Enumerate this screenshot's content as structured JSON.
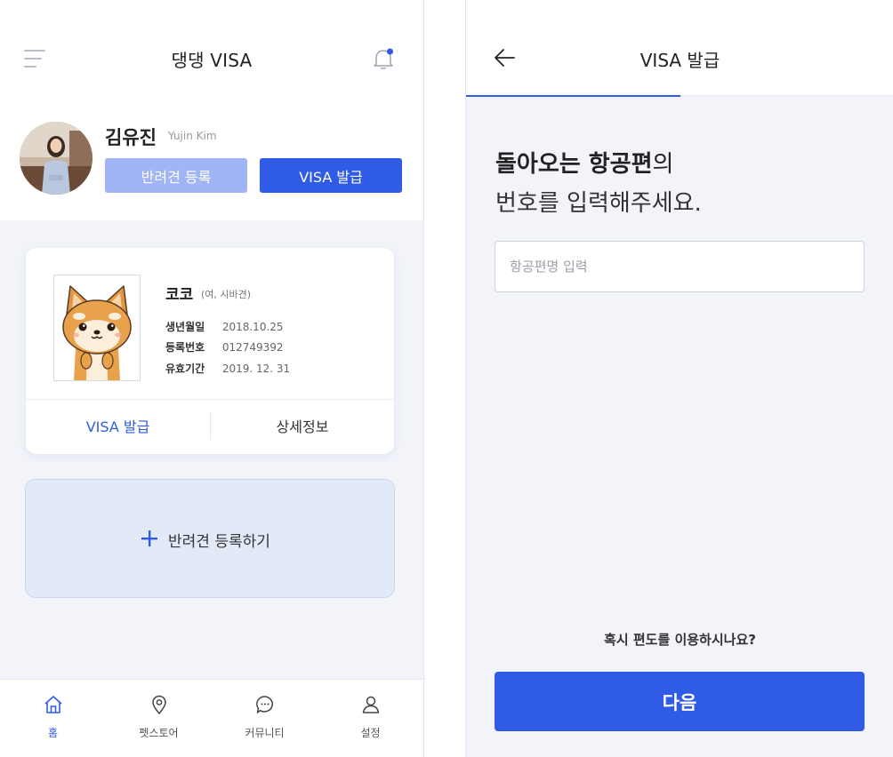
{
  "left": {
    "app_title": "댕댕 VISA",
    "user": {
      "name": "김유진",
      "name_en": "Yujin Kim"
    },
    "buttons": {
      "register": "반려견 등록",
      "visa": "VISA 발급"
    },
    "dog_card": {
      "name": "코코",
      "meta": "(여, 시바견)",
      "info": [
        {
          "label": "생년월일",
          "value": "2018.10.25"
        },
        {
          "label": "등록번호",
          "value": "012749392"
        },
        {
          "label": "유효기간",
          "value": "2019. 12. 31"
        }
      ],
      "visa_action": "VISA 발급",
      "detail_action": "상세정보"
    },
    "add_dog": "반려견 등록하기",
    "tabs": [
      {
        "label": "홈",
        "icon": "home-icon"
      },
      {
        "label": "펫스토어",
        "icon": "location-pin-icon"
      },
      {
        "label": "커뮤니티",
        "icon": "chat-bubble-icon"
      },
      {
        "label": "설정",
        "icon": "user-icon"
      }
    ],
    "active_tab": "홈"
  },
  "right": {
    "title": "VISA 발급",
    "progress": 0.5,
    "question": {
      "bold1": "돌아오는 항공편",
      "rest1": "의",
      "line2": "번호를 입력해주세요."
    },
    "flight_input": {
      "placeholder": "항공편명 입력",
      "value": ""
    },
    "oneway_link": "혹시 편도를 이용하시나요?",
    "next_button": "다음"
  },
  "colors": {
    "primary": "#2f5be6",
    "primary_light": "#a0b4f6",
    "background": "#f2f4fa",
    "add_card_bg": "#e3eaf7"
  }
}
